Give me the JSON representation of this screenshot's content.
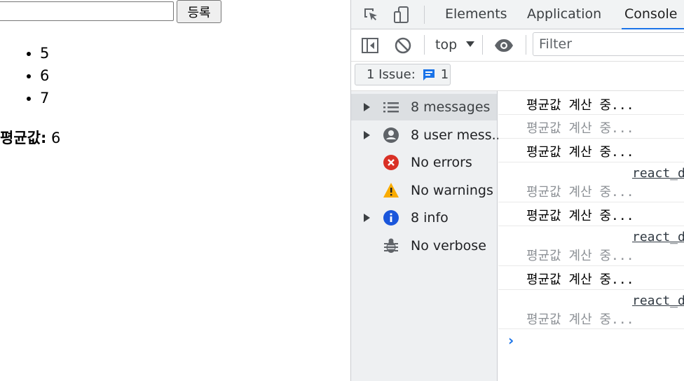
{
  "page": {
    "input_value": "",
    "register_button": "등록",
    "list_items": [
      "5",
      "6",
      "7"
    ],
    "average_label": "평균값:",
    "average_value": "6"
  },
  "devtools": {
    "tabs": [
      "Elements",
      "Application",
      "Console"
    ],
    "active_tab": "Console",
    "context": "top",
    "filter_placeholder": "Filter",
    "issues": {
      "label": "1 Issue:",
      "count": "1"
    },
    "sidebar": [
      {
        "label": "8 messages",
        "icon": "list-icon",
        "expandable": true
      },
      {
        "label": "8 user mess...",
        "icon": "user-icon",
        "expandable": true
      },
      {
        "label": "No errors",
        "icon": "error-icon",
        "expandable": false
      },
      {
        "label": "No warnings",
        "icon": "warning-icon",
        "expandable": false
      },
      {
        "label": "8 info",
        "icon": "info-icon",
        "expandable": true
      },
      {
        "label": "No verbose",
        "icon": "bug-icon",
        "expandable": false
      }
    ],
    "messages": [
      {
        "text": "평균값 계산 중...",
        "dim": false,
        "source": ""
      },
      {
        "text": "평균값 계산 중...",
        "dim": true,
        "source": ""
      },
      {
        "text": "평균값 계산 중...",
        "dim": false,
        "source": ""
      },
      {
        "text": "평균값 계산 중...",
        "dim": true,
        "source": "react_d"
      },
      {
        "text": "평균값 계산 중...",
        "dim": false,
        "source": ""
      },
      {
        "text": "평균값 계산 중...",
        "dim": true,
        "source": "react_d"
      },
      {
        "text": "평균값 계산 중...",
        "dim": false,
        "source": ""
      },
      {
        "text": "평균값 계산 중...",
        "dim": true,
        "source": "react_d"
      }
    ],
    "prompt": "›",
    "colors": {
      "accent": "#1a73e8",
      "error": "#d93025",
      "warning": "#f9ab00",
      "info": "#1a73e8"
    }
  }
}
